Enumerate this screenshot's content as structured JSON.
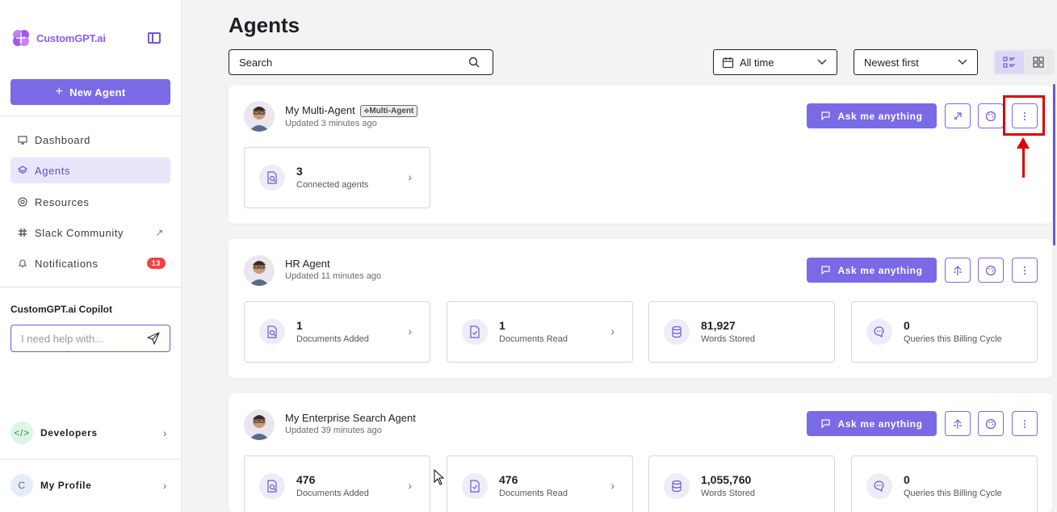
{
  "brand": {
    "name": "CustomGPT.ai"
  },
  "sidebar": {
    "new_agent_label": "New Agent",
    "items": [
      {
        "label": "Dashboard",
        "icon": "monitor-icon"
      },
      {
        "label": "Agents",
        "icon": "layers-icon",
        "active": true
      },
      {
        "label": "Resources",
        "icon": "lifebuoy-icon"
      },
      {
        "label": "Slack Community",
        "icon": "slack-icon",
        "external": true
      },
      {
        "label": "Notifications",
        "icon": "bell-icon",
        "badge": "13"
      }
    ],
    "copilot": {
      "title": "CustomGPT.ai Copilot",
      "placeholder": "I need help with..."
    },
    "developers_label": "Developers",
    "profile": {
      "initial": "C",
      "label": "My Profile"
    }
  },
  "main": {
    "title": "Agents",
    "search_label": "Search",
    "time_filter": "All time",
    "sort": "Newest first"
  },
  "agents": [
    {
      "name": "My Multi-Agent",
      "tag": "Multi-Agent",
      "updated": "Updated 3 minutes ago",
      "ask_label": "Ask me anything",
      "stats": [
        {
          "value": "3",
          "label": "Connected agents",
          "icon": "doc-search-icon",
          "link": true
        }
      ]
    },
    {
      "name": "HR Agent",
      "updated": "Updated 11 minutes ago",
      "ask_label": "Ask me anything",
      "stats": [
        {
          "value": "1",
          "label": "Documents Added",
          "icon": "doc-search-icon",
          "link": true
        },
        {
          "value": "1",
          "label": "Documents Read",
          "icon": "doc-check-icon",
          "link": true
        },
        {
          "value": "81,927",
          "label": "Words Stored",
          "icon": "database-icon"
        },
        {
          "value": "0",
          "label": "Queries this Billing Cycle",
          "icon": "chat-icon"
        }
      ]
    },
    {
      "name": "My Enterprise Search Agent",
      "updated": "Updated 39 minutes ago",
      "ask_label": "Ask me anything",
      "stats": [
        {
          "value": "476",
          "label": "Documents Added",
          "icon": "doc-search-icon",
          "link": true
        },
        {
          "value": "476",
          "label": "Documents Read",
          "icon": "doc-check-icon",
          "link": true
        },
        {
          "value": "1,055,760",
          "label": "Words Stored",
          "icon": "database-icon"
        },
        {
          "value": "0",
          "label": "Queries this Billing Cycle",
          "icon": "chat-icon"
        }
      ]
    }
  ],
  "colors": {
    "accent": "#7a6ae6",
    "annotation": "#e00000",
    "badge": "#ef4444"
  }
}
